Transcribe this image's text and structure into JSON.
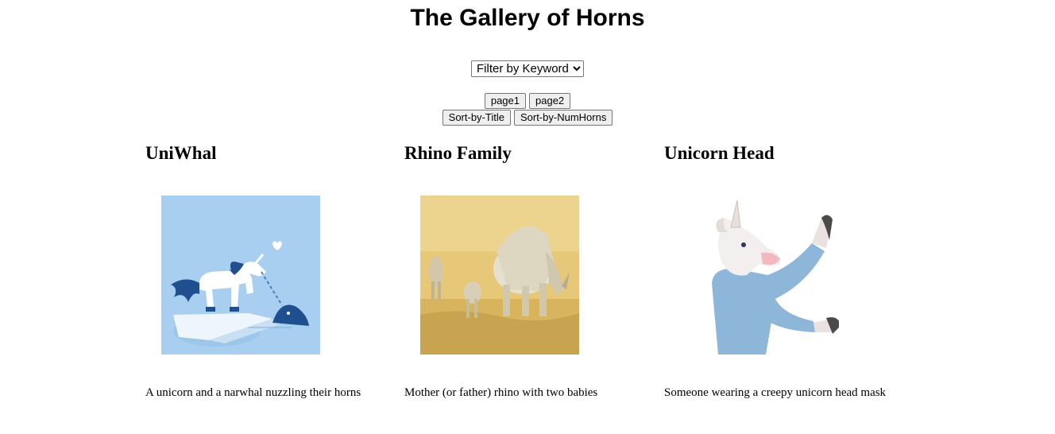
{
  "page": {
    "title": "The Gallery of Horns"
  },
  "filter": {
    "selected": "Filter by Keyword"
  },
  "pagination": {
    "page1": "page1",
    "page2": "page2"
  },
  "sort": {
    "by_title": "Sort-by-Title",
    "by_numhorns": "Sort-by-NumHorns"
  },
  "cards": [
    {
      "title": "UniWhal",
      "description": "A unicorn and a narwhal nuzzling their horns",
      "image": "unicorn-narwhal-illustration"
    },
    {
      "title": "Rhino Family",
      "description": "Mother (or father) rhino with two babies",
      "image": "rhino-family-photo"
    },
    {
      "title": "Unicorn Head",
      "description": "Someone wearing a creepy unicorn head mask",
      "image": "unicorn-mask-person-photo"
    }
  ]
}
